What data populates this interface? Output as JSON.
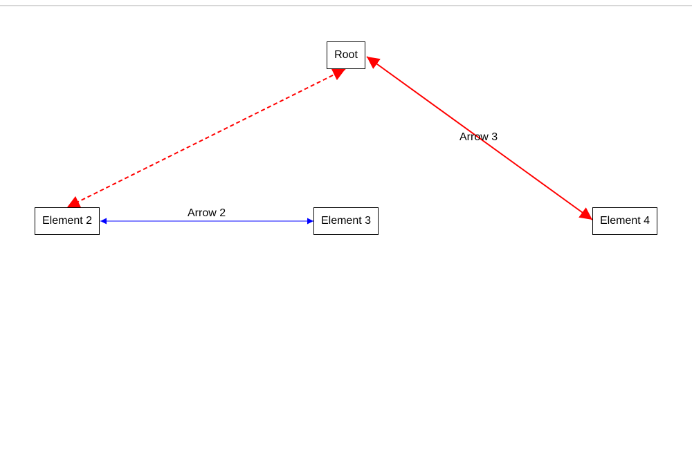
{
  "diagram": {
    "nodes": [
      {
        "id": "root",
        "label": "Root"
      },
      {
        "id": "element2",
        "label": "Element 2"
      },
      {
        "id": "element3",
        "label": "Element 3"
      },
      {
        "id": "element4",
        "label": "Element 4"
      }
    ],
    "edges": [
      {
        "id": "arrow1",
        "from": "root",
        "to": "element2",
        "label": "",
        "style": "dashed",
        "color": "#ff0000",
        "arrowheads": "both"
      },
      {
        "id": "arrow2",
        "from": "element2",
        "to": "element3",
        "label": "Arrow 2",
        "style": "solid",
        "color": "#0000ff",
        "arrowheads": "both"
      },
      {
        "id": "arrow3",
        "from": "root",
        "to": "element4",
        "label": "Arrow 3",
        "style": "solid",
        "color": "#ff0000",
        "arrowheads": "both"
      }
    ]
  }
}
